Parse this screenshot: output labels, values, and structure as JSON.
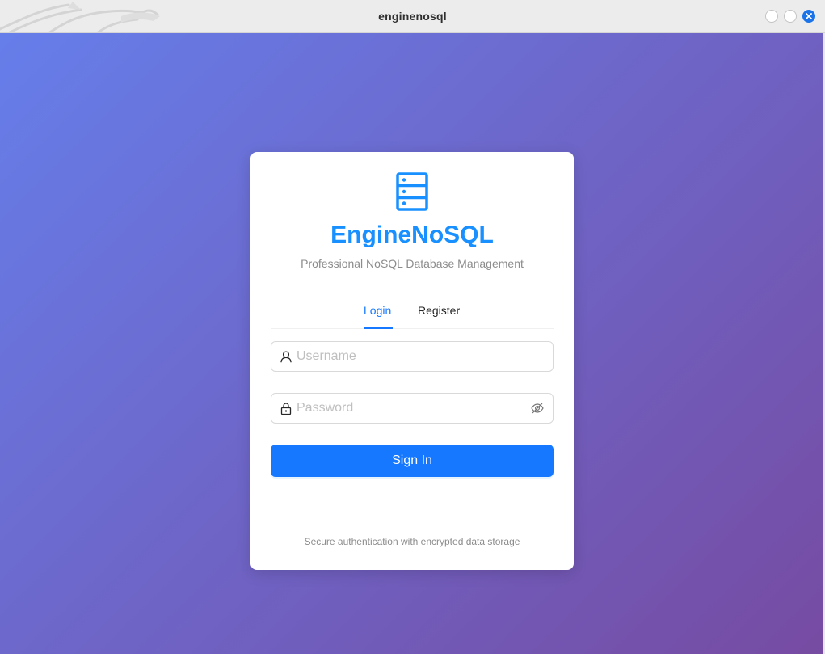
{
  "window": {
    "title": "enginenosql"
  },
  "login_card": {
    "app_name": "EngineNoSQL",
    "tagline": "Professional NoSQL Database Management",
    "tabs": [
      {
        "label": "Login",
        "active": true
      },
      {
        "label": "Register",
        "active": false
      }
    ],
    "username": {
      "placeholder": "Username",
      "value": ""
    },
    "password": {
      "placeholder": "Password",
      "value": ""
    },
    "sign_in_label": "Sign In",
    "footer_note": "Secure authentication with encrypted data storage"
  },
  "icons": {
    "logo": "database-server-icon",
    "username_prefix": "user-icon",
    "password_prefix": "lock-icon",
    "password_suffix": "eye-invisible-icon",
    "close": "close-icon"
  },
  "colors": {
    "brand": "#1890ff",
    "primary_button": "#1677ff",
    "background_gradient_start": "#667eea",
    "background_gradient_end": "#764ba2",
    "close_button": "#1a73e8"
  }
}
